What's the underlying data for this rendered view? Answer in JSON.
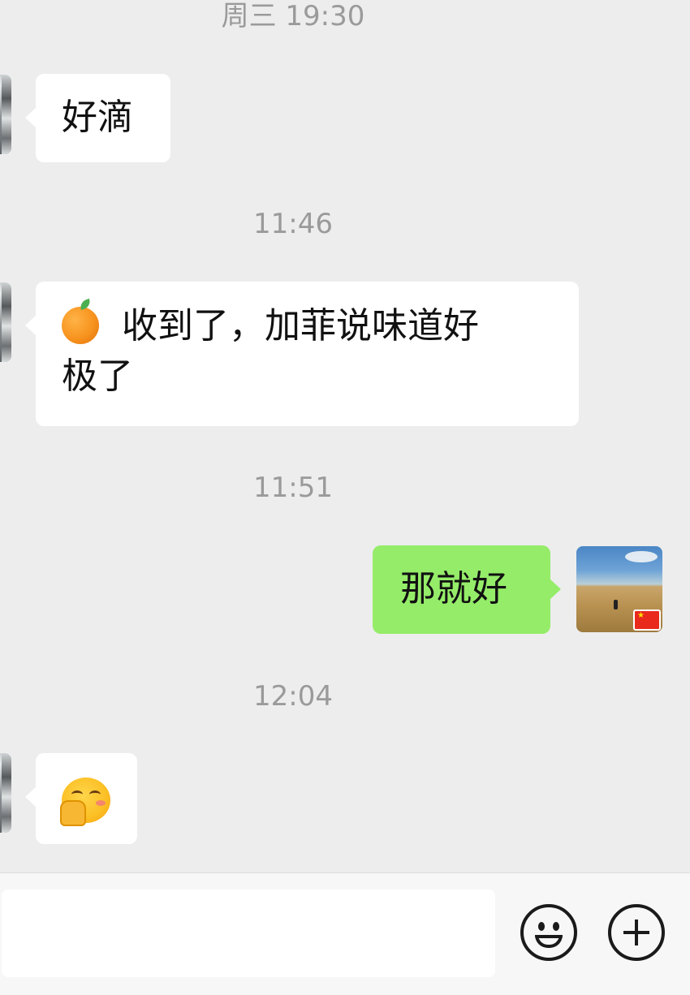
{
  "chat": {
    "messages": [
      {
        "type": "timestamp",
        "text": "周三 19:30"
      },
      {
        "type": "received",
        "text": "好滴"
      },
      {
        "type": "timestamp",
        "text": "11:46"
      },
      {
        "type": "received",
        "emoji": "orange-emoji",
        "line1": "收到了，加菲说味道好",
        "line2": "极了"
      },
      {
        "type": "timestamp",
        "text": "11:51"
      },
      {
        "type": "sent",
        "text": "那就好"
      },
      {
        "type": "timestamp",
        "text": "12:04"
      },
      {
        "type": "received",
        "emoji": "shushing-face-emoji"
      }
    ]
  },
  "input_bar": {
    "input_value": "",
    "icons": [
      "emoji-face-icon",
      "plus-icon"
    ]
  },
  "colors": {
    "background": "#ededed",
    "received_bubble": "#ffffff",
    "sent_bubble": "#95ec69",
    "timestamp_text": "#9a9a9a"
  }
}
